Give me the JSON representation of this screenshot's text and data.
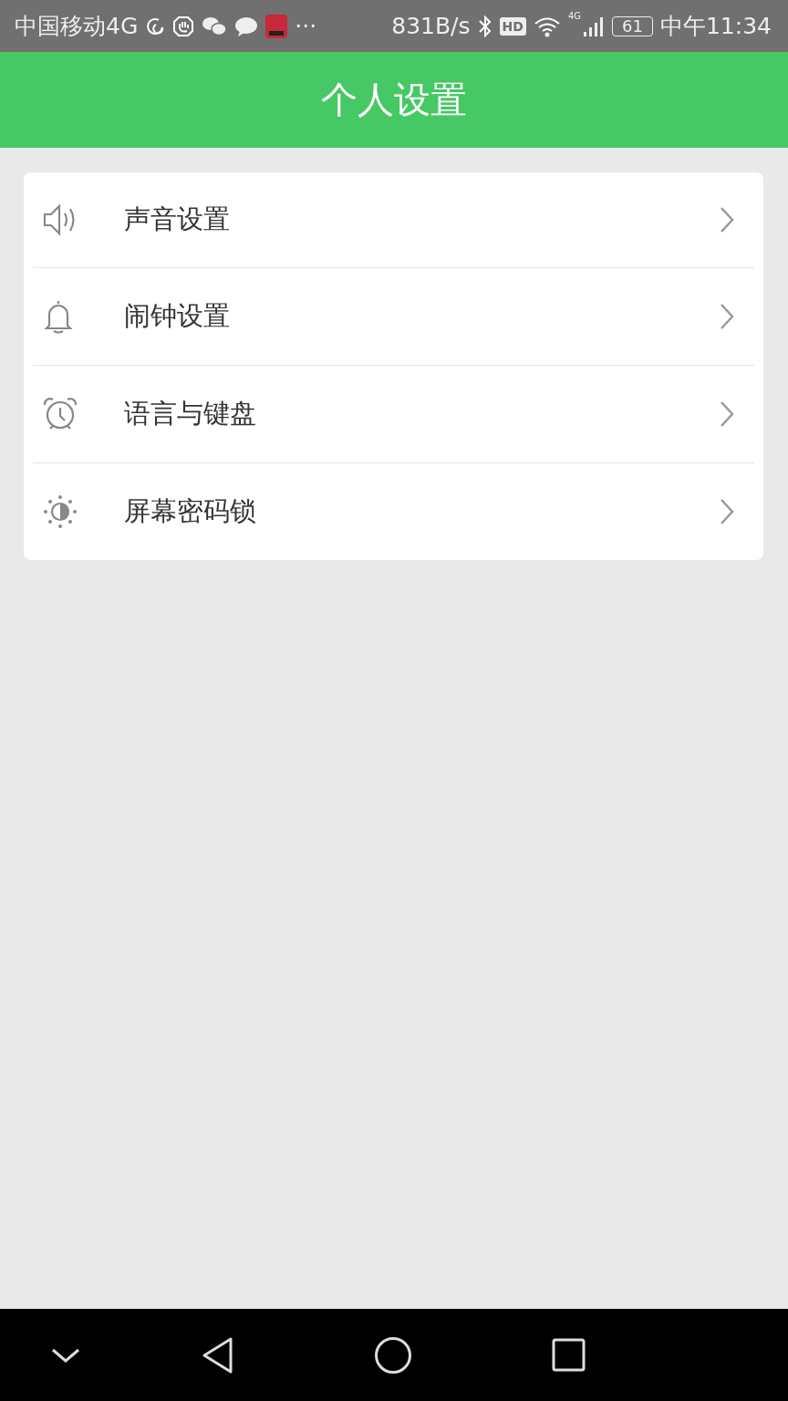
{
  "status_bar": {
    "carrier": "中国移动4G",
    "more": "···",
    "speed": "831B/s",
    "hd": "HD",
    "network": "4G",
    "battery": "61",
    "time": "中午11:34"
  },
  "header": {
    "title": "个人设置"
  },
  "menu": [
    {
      "kind": "sound",
      "label": "声音设置"
    },
    {
      "kind": "bell",
      "label": "闹钟设置"
    },
    {
      "kind": "alarm",
      "label": "语言与键盘"
    },
    {
      "kind": "brightness",
      "label": "屏幕密码锁"
    }
  ],
  "nav_bar": {
    "buttons": [
      {
        "kind": "down"
      },
      {
        "kind": "back"
      },
      {
        "kind": "home"
      },
      {
        "kind": "recent"
      }
    ]
  }
}
